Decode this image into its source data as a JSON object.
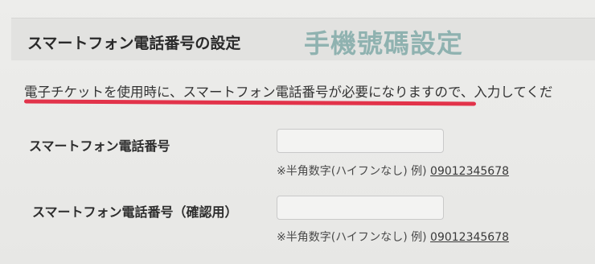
{
  "section": {
    "title": "スマートフォン電話番号の設定",
    "overlay_label": "手機號碼設定"
  },
  "notice": "電子チケットを使用時に、スマートフォン電話番号が必要になりますので、入力してくだ",
  "fields": [
    {
      "label": "スマートフォン電話番号",
      "value": "",
      "hint": "※半角数字(ハイフンなし) 例)",
      "example": "09012345678"
    },
    {
      "label": "スマートフォン電話番号（確認用）",
      "value": "",
      "hint": "※半角数字(ハイフンなし) 例)",
      "example": "09012345678"
    }
  ],
  "colors": {
    "underline": "#e2334a",
    "overlay_text": "#8fb2b0",
    "header_bg": "#e2e2e0"
  }
}
